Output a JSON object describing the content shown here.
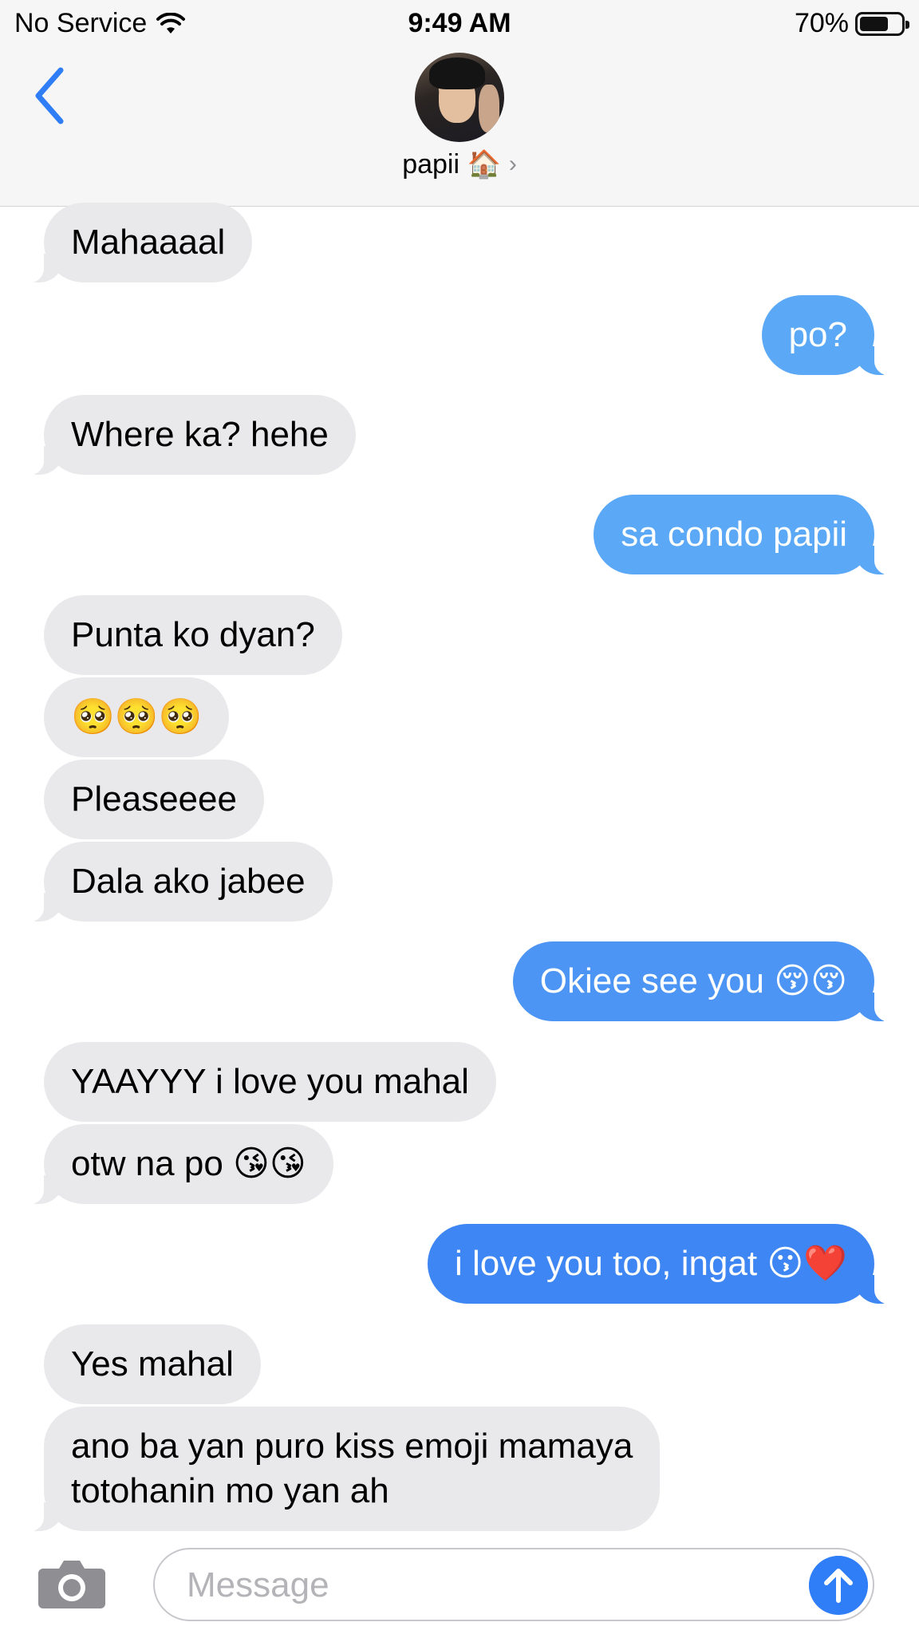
{
  "status_bar": {
    "carrier": "No Service",
    "time": "9:49 AM",
    "battery_percent_label": "70%",
    "battery_level": 0.7
  },
  "header": {
    "back_icon": "chevron-left-icon",
    "contact_name": "papii 🏠",
    "contact_chevron": "›"
  },
  "colors": {
    "incoming_bubble": "#e9e9eb",
    "outgoing_light": "#5ba9f6",
    "outgoing_mid": "#4d95f4",
    "outgoing_dark": "#3d86f3",
    "accent": "#2f7ef7"
  },
  "messages": [
    {
      "direction": "in",
      "text": "Mahaaaal"
    },
    {
      "direction": "out",
      "text": "po?"
    },
    {
      "direction": "in",
      "text": "Where ka? hehe"
    },
    {
      "direction": "out",
      "text": "sa condo papii"
    },
    {
      "direction": "in",
      "text": "Punta ko dyan?"
    },
    {
      "direction": "in",
      "text": "🥺🥺🥺"
    },
    {
      "direction": "in",
      "text": "Pleaseeee"
    },
    {
      "direction": "in",
      "text": "Dala ako jabee"
    },
    {
      "direction": "out",
      "text": "Okiee see you 😚😚"
    },
    {
      "direction": "in",
      "text": "YAAYYY i love you mahal"
    },
    {
      "direction": "in",
      "text": "otw na po 😘😘"
    },
    {
      "direction": "out",
      "text": "i love you too, ingat 😗❤️"
    },
    {
      "direction": "in",
      "text": "Yes mahal"
    },
    {
      "direction": "in",
      "text": "ano ba yan puro kiss emoji mamaya\ntotohanin mo yan ah"
    }
  ],
  "input_bar": {
    "camera_icon": "camera-icon",
    "placeholder": "Message",
    "send_icon": "arrow-up-icon"
  }
}
